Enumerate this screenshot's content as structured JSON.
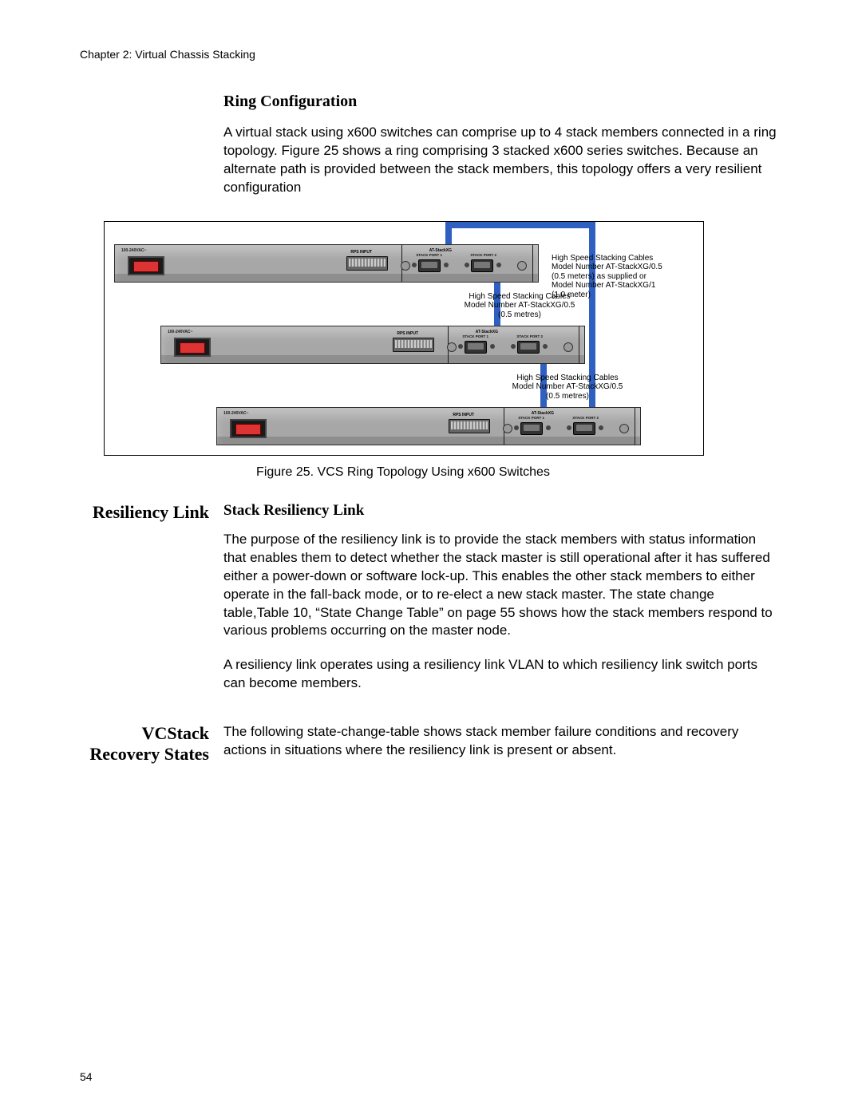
{
  "chapter": "Chapter 2: Virtual Chassis Stacking",
  "page_number": "54",
  "ring_config": {
    "title": "Ring Configuration",
    "body": "A virtual stack using x600 switches can comprise up to 4 stack members connected in a ring topology. Figure 25 shows a ring comprising 3 stacked x600 series switches. Because an alternate path is provided between the stack members, this topology offers a very resilient configuration"
  },
  "figure": {
    "caption": "Figure 25. VCS Ring Topology Using x600 Switches",
    "switch_labels": {
      "power": "100-240VAC~",
      "rps": "RPS INPUT",
      "stack_module": "AT-StackXG",
      "port1": "STACK PORT 1",
      "port2": "STACK PORT 2"
    },
    "annotations": {
      "right": "High Speed Stacking Cables\nModel Number AT-StackXG/0.5\n(0.5 meters) as supplied or\nModel Number AT-StackXG/1\n(1.0 meter)",
      "mid1": "High Speed Stacking Cables\nModel Number AT-StackXG/0.5\n(0.5 metres)",
      "mid2": "High Speed Stacking Cables\nModel Number AT-StackXG/0.5\n(0.5 metres)"
    }
  },
  "resiliency": {
    "side_heading": "Resiliency Link",
    "sub_title": "Stack Resiliency Link",
    "p1": "The purpose of the resiliency link is to provide the stack members with status information that enables them to detect whether the stack master is still operational after it has suffered either a power-down or software lock-up. This enables the other stack members to either operate in the fall-back mode, or to re-elect a new stack master. The state change table,Table 10, “State Change Table” on page 55 shows how the stack members respond to various problems occurring on the master node.",
    "p2": "A resiliency link operates using a resiliency link VLAN to which resiliency link switch ports can become members."
  },
  "recovery": {
    "side_heading": "VCStack Recovery States",
    "body": "The following state-change-table shows stack member failure conditions and recovery actions in situations where the resiliency link is present or absent."
  }
}
